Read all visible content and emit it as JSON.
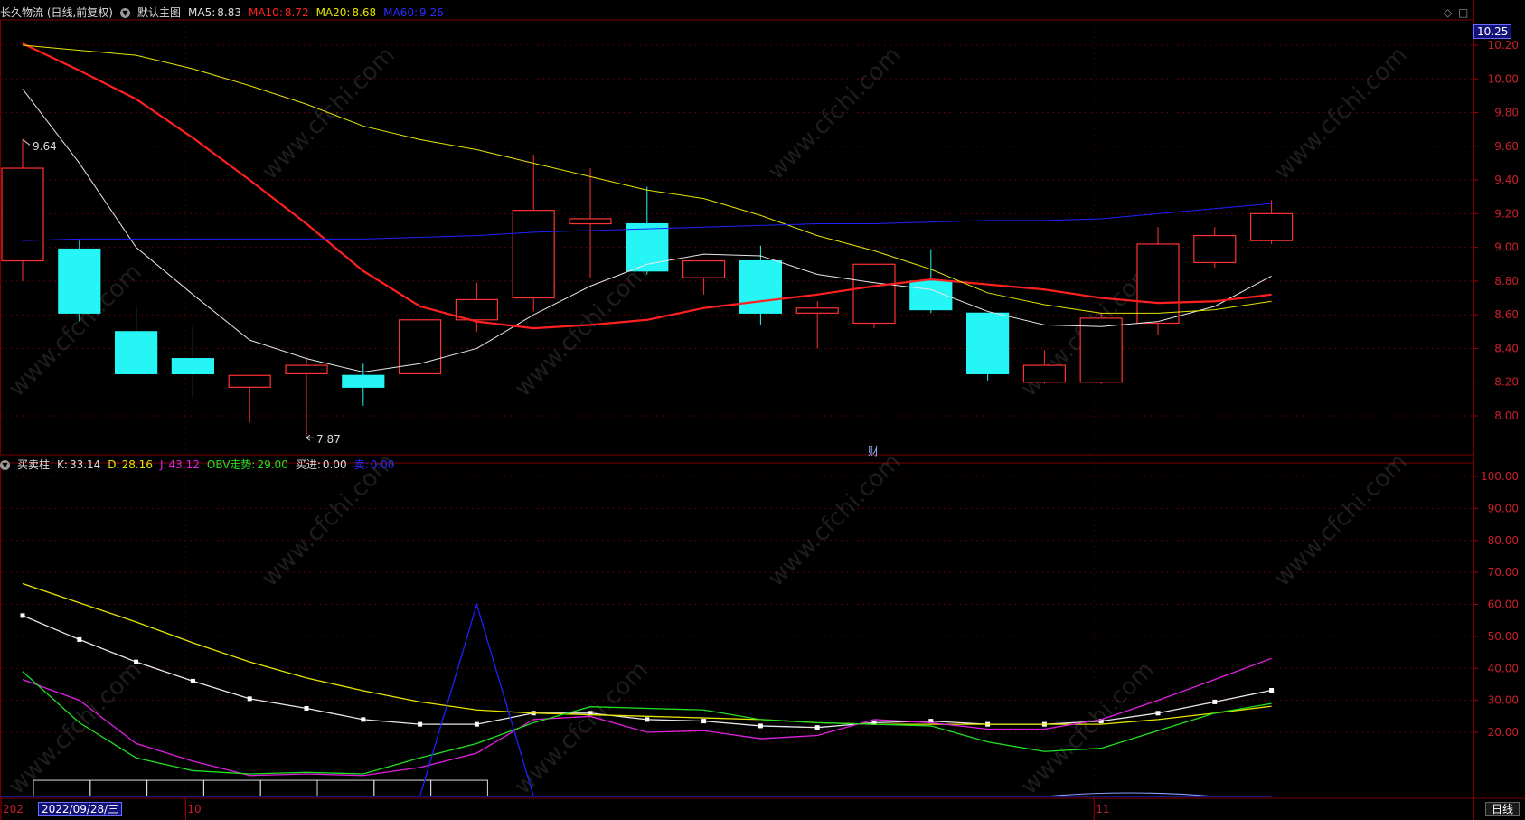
{
  "main_panel": {
    "title": "长久物流 (日线,前复权)",
    "indicator_name": "默认主图",
    "ma5": {
      "label": "MA5:",
      "value": "8.83",
      "color": "#ffffff"
    },
    "ma10": {
      "label": "MA10:",
      "value": "8.72",
      "color": "#ff2020"
    },
    "ma20": {
      "label": "MA20:",
      "value": "8.68",
      "color": "#e5e500"
    },
    "ma60": {
      "label": "MA60:",
      "value": "9.26",
      "color": "#2020ff"
    },
    "high_mark": "9.64",
    "low_mark": "7.87",
    "event_marker": "财",
    "current_price": "10.25",
    "icons": [
      "diamond-icon",
      "maximize-icon"
    ]
  },
  "sub_panel": {
    "title": "买卖柱",
    "k": {
      "label": "K:",
      "value": "33.14",
      "color": "#ffffff"
    },
    "d": {
      "label": "D:",
      "value": "28.16",
      "color": "#e5e500"
    },
    "j": {
      "label": "J:",
      "value": "43.12",
      "color": "#e020e0"
    },
    "obv": {
      "label": "OBV走势:",
      "value": "29.00",
      "color": "#20e020"
    },
    "buy": {
      "label": "买进:",
      "value": "0.00",
      "color": "#dddddd"
    },
    "sell": {
      "label": "卖:",
      "value": "0.00",
      "color": "#2020ff"
    }
  },
  "x_axis": {
    "labels": [
      {
        "text": "202",
        "date_index": 0
      },
      {
        "text": "10",
        "date_index": 3
      },
      {
        "text": "11",
        "date_index": 19
      }
    ],
    "cursor_date": "2022/09/28/三"
  },
  "period_button": "日线",
  "watermark": "www.cfchi.com",
  "chart_data": [
    {
      "type": "candlestick",
      "title": "长久物流 (日线,前复权)",
      "ylim": [
        7.72,
        10.32
      ],
      "y_ticks": [
        "10.20",
        "10.00",
        "9.80",
        "9.60",
        "9.40",
        "9.20",
        "9.00",
        "8.80",
        "8.60",
        "8.40",
        "8.20",
        "8.00"
      ],
      "candles": [
        {
          "o": 8.92,
          "h": 9.64,
          "l": 8.8,
          "c": 9.47
        },
        {
          "o": 8.99,
          "h": 9.04,
          "l": 8.56,
          "c": 8.61
        },
        {
          "o": 8.5,
          "h": 8.65,
          "l": 8.25,
          "c": 8.25
        },
        {
          "o": 8.34,
          "h": 8.53,
          "l": 8.11,
          "c": 8.25
        },
        {
          "o": 8.17,
          "h": 8.24,
          "l": 7.96,
          "c": 8.24
        },
        {
          "o": 8.25,
          "h": 8.35,
          "l": 7.87,
          "c": 8.3
        },
        {
          "o": 8.24,
          "h": 8.31,
          "l": 8.06,
          "c": 8.17
        },
        {
          "o": 8.25,
          "h": 8.57,
          "l": 8.25,
          "c": 8.57
        },
        {
          "o": 8.57,
          "h": 8.79,
          "l": 8.5,
          "c": 8.69
        },
        {
          "o": 8.7,
          "h": 9.55,
          "l": 8.62,
          "c": 9.22
        },
        {
          "o": 9.14,
          "h": 9.47,
          "l": 8.82,
          "c": 9.17
        },
        {
          "o": 9.14,
          "h": 9.36,
          "l": 8.84,
          "c": 8.86
        },
        {
          "o": 8.82,
          "h": 8.92,
          "l": 8.72,
          "c": 8.92
        },
        {
          "o": 8.92,
          "h": 9.01,
          "l": 8.54,
          "c": 8.61
        },
        {
          "o": 8.61,
          "h": 8.68,
          "l": 8.4,
          "c": 8.64
        },
        {
          "o": 8.55,
          "h": 8.9,
          "l": 8.52,
          "c": 8.9
        },
        {
          "o": 8.8,
          "h": 8.99,
          "l": 8.61,
          "c": 8.63
        },
        {
          "o": 8.61,
          "h": 8.61,
          "l": 8.21,
          "c": 8.25
        },
        {
          "o": 8.2,
          "h": 8.39,
          "l": 8.19,
          "c": 8.3
        },
        {
          "o": 8.2,
          "h": 8.61,
          "l": 8.19,
          "c": 8.58
        },
        {
          "o": 8.55,
          "h": 9.12,
          "l": 8.48,
          "c": 9.02
        },
        {
          "o": 8.91,
          "h": 9.12,
          "l": 8.88,
          "c": 9.07
        },
        {
          "o": 9.04,
          "h": 9.28,
          "l": 9.02,
          "c": 9.2
        }
      ],
      "series": [
        {
          "name": "MA5",
          "color": "#e8e8e8",
          "width": 1,
          "values": [
            9.94,
            9.5,
            9.0,
            8.72,
            8.45,
            8.34,
            8.26,
            8.31,
            8.4,
            8.6,
            8.77,
            8.9,
            8.96,
            8.95,
            8.84,
            8.79,
            8.75,
            8.62,
            8.54,
            8.53,
            8.56,
            8.65,
            8.83
          ]
        },
        {
          "name": "MA10",
          "color": "#ff2020",
          "width": 2.2,
          "values": [
            10.21,
            10.05,
            9.88,
            9.65,
            9.4,
            9.14,
            8.86,
            8.65,
            8.56,
            8.52,
            8.54,
            8.57,
            8.64,
            8.68,
            8.72,
            8.77,
            8.81,
            8.78,
            8.75,
            8.7,
            8.67,
            8.68,
            8.72
          ]
        },
        {
          "name": "MA20",
          "color": "#e5e500",
          "width": 1,
          "values": [
            10.2,
            10.17,
            10.14,
            10.06,
            9.96,
            9.85,
            9.72,
            9.64,
            9.58,
            9.5,
            9.42,
            9.34,
            9.29,
            9.19,
            9.07,
            8.98,
            8.87,
            8.73,
            8.66,
            8.61,
            8.61,
            8.63,
            8.68
          ]
        },
        {
          "name": "MA60",
          "color": "#2020ff",
          "width": 1,
          "values": [
            9.04,
            9.05,
            9.05,
            9.05,
            9.05,
            9.05,
            9.05,
            9.06,
            9.07,
            9.09,
            9.1,
            9.11,
            9.12,
            9.13,
            9.14,
            9.14,
            9.15,
            9.16,
            9.16,
            9.17,
            9.2,
            9.23,
            9.26
          ]
        }
      ]
    },
    {
      "type": "line",
      "title": "买卖柱",
      "ylim": [
        0,
        106
      ],
      "y_ticks": [
        "100.00",
        "90.00",
        "80.00",
        "70.00",
        "60.00",
        "50.00",
        "40.00",
        "30.00",
        "20.00"
      ],
      "series": [
        {
          "name": "K",
          "color": "#e8e8e8",
          "markers": true,
          "values": [
            56.5,
            49,
            42,
            36,
            30.5,
            27.5,
            24,
            22.5,
            22.5,
            26,
            26,
            24,
            23.5,
            22,
            21.5,
            23,
            23.5,
            22.5,
            22.5,
            23.5,
            26,
            29.5,
            33.14
          ]
        },
        {
          "name": "D",
          "color": "#e5e500",
          "markers": false,
          "values": [
            66.5,
            60.5,
            54.5,
            48,
            42,
            37,
            33,
            29.5,
            27,
            26,
            25.5,
            25,
            24.5,
            24,
            23,
            22.5,
            22.5,
            22.5,
            22.5,
            22.5,
            24,
            26,
            28.16
          ]
        },
        {
          "name": "J",
          "color": "#e020e0",
          "markers": false,
          "values": [
            36.5,
            30,
            16.5,
            11,
            6.5,
            7,
            6.5,
            9,
            13.5,
            24,
            25,
            20,
            20.5,
            18,
            19,
            24,
            23,
            21,
            21,
            24,
            30,
            36.5,
            43.12
          ]
        },
        {
          "name": "OBV走势",
          "color": "#20e020",
          "markers": false,
          "values": [
            39,
            23,
            12,
            8,
            7,
            7.5,
            7,
            12,
            16.5,
            23,
            28,
            27.5,
            27,
            24,
            23,
            22.5,
            22,
            17,
            14,
            15,
            20.5,
            26,
            29.0
          ]
        },
        {
          "name": "买进",
          "color": "#2020ff",
          "markers": false,
          "values": [
            0,
            0,
            0,
            0,
            0,
            0,
            0,
            0,
            60,
            0,
            0,
            0,
            0,
            0,
            0,
            0,
            0,
            0,
            0,
            0,
            0,
            0,
            0
          ]
        }
      ]
    }
  ]
}
